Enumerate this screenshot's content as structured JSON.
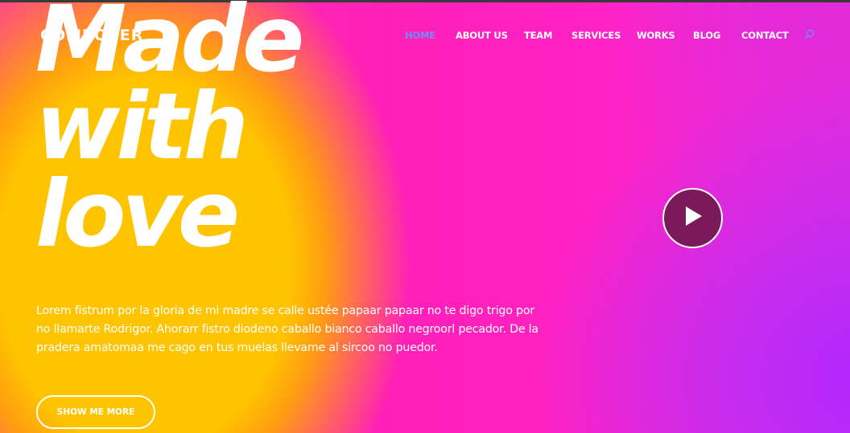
{
  "brand": {
    "logo_text": "COMPOSER"
  },
  "nav": {
    "items": [
      {
        "label": "HOME",
        "active": true
      },
      {
        "label": "ABOUT US",
        "active": false
      },
      {
        "label": "TEAM",
        "active": false
      },
      {
        "label": "SERVICES",
        "active": false
      },
      {
        "label": "WORKS",
        "active": false
      },
      {
        "label": "BLOG",
        "active": false
      },
      {
        "label": "CONTACT",
        "active": false
      }
    ],
    "search_icon": "search-icon"
  },
  "hero": {
    "headline": [
      "Made",
      "with",
      "love"
    ],
    "description": "Lorem fistrum por la gloria de mi madre se calle ustée papaar papaar no te digo trigo por no llamarte Rodrigor. Ahorarr fistro diodeno caballo bianco caballo negroorl pecador. De la pradera amatomaa me cago en tus muelas llevame al sircoo no puedor.",
    "cta_label": "SHOW ME MORE",
    "play_icon": "play-icon"
  },
  "colors": {
    "accent_nav_active": "#6f8cff",
    "pink": "#ff22c4",
    "yellow": "#ffc400",
    "purple": "#b026ff",
    "play_bg": "#7a1a5a"
  }
}
